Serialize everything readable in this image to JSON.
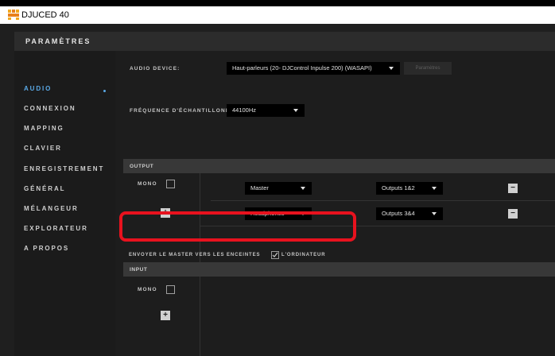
{
  "window": {
    "title": "DJUCED 40"
  },
  "header": {
    "title": "PARAMÈTRES"
  },
  "sidebar": {
    "items": [
      {
        "label": "AUDIO",
        "active": true
      },
      {
        "label": "CONNEXION"
      },
      {
        "label": "MAPPING"
      },
      {
        "label": "CLAVIER"
      },
      {
        "label": "ENREGISTREMENT"
      },
      {
        "label": "GÉNÉRAL"
      },
      {
        "label": "MÉLANGEUR"
      },
      {
        "label": "EXPLORATEUR"
      },
      {
        "label": "A PROPOS"
      }
    ]
  },
  "audio": {
    "device_label": "AUDIO DEVICE:",
    "device_value": "Haut-parleurs (20- DJControl Inpulse 200) (WASAPI)",
    "settings_button": "Paramètres",
    "sample_rate_label": "FRÉQUENCE D'ÉCHANTILLONN",
    "sample_rate_value": "44100Hz"
  },
  "output": {
    "title": "OUTPUT",
    "mono_label": "MONO",
    "rows": [
      {
        "channel": "Master",
        "outputs": "Outputs 1&2",
        "remove": "−"
      },
      {
        "channel": "Headphones",
        "outputs": "Outputs 3&4",
        "remove": "−"
      }
    ],
    "add_label": "+"
  },
  "send_master": {
    "label_before": "ENVOYER LE MASTER VERS LES ENCEINTES",
    "label_after": "L'ORDINATEUR",
    "checked": true
  },
  "input": {
    "title": "INPUT",
    "mono_label": "MONO",
    "add_label": "+"
  },
  "colors": {
    "accent": "#5aa9e6",
    "highlight": "#e8121e"
  }
}
